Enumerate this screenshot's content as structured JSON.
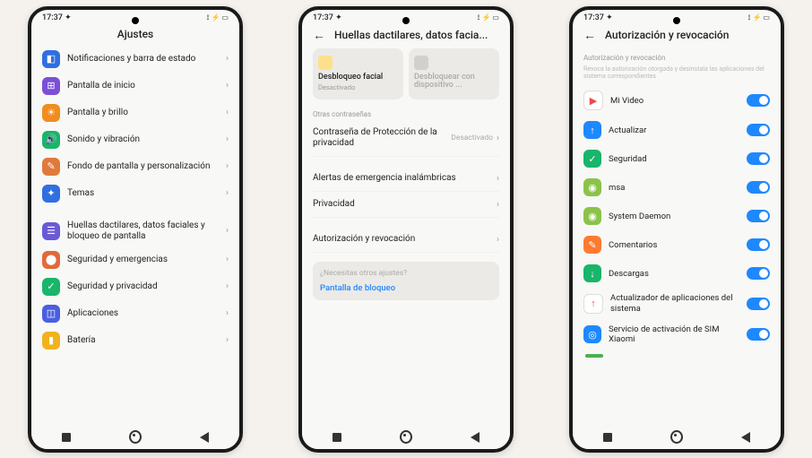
{
  "status": {
    "time": "17:37",
    "dot": "✦",
    "icons": "⟟ ⚡ ▭"
  },
  "phone1": {
    "title": "Ajustes",
    "items": [
      {
        "label": "Notificaciones y barra de estado",
        "color": "#2f6fe0",
        "glyph": "◧"
      },
      {
        "label": "Pantalla de inicio",
        "color": "#7b4fd6",
        "glyph": "⊞"
      },
      {
        "label": "Pantalla y brillo",
        "color": "#f28c1e",
        "glyph": "☀"
      },
      {
        "label": "Sonido y vibración",
        "color": "#18b56a",
        "glyph": "🔊"
      },
      {
        "label": "Fondo de pantalla y personalización",
        "color": "#e07a3b",
        "glyph": "✎"
      },
      {
        "label": "Temas",
        "color": "#2f6fe0",
        "glyph": "✦"
      }
    ],
    "items2": [
      {
        "label": "Huellas dactilares, datos faciales y bloqueo de pantalla",
        "color": "#6a5ad6",
        "glyph": "☰"
      },
      {
        "label": "Seguridad y emergencias",
        "color": "#e06a3b",
        "glyph": "⬤"
      },
      {
        "label": "Seguridad y privacidad",
        "color": "#18b56a",
        "glyph": "✓"
      },
      {
        "label": "Aplicaciones",
        "color": "#4a5fe0",
        "glyph": "◫"
      },
      {
        "label": "Batería",
        "color": "#f2b21e",
        "glyph": "▮"
      }
    ]
  },
  "phone2": {
    "title": "Huellas dactilares, datos facia...",
    "card1": {
      "title": "Desbloqueo facial",
      "sub": "Desactivado"
    },
    "card2": {
      "title": "Desbloquear con dispositivo ...",
      "sub": ""
    },
    "section1": "Otras contraseñas",
    "rows": [
      {
        "label": "Contraseña de Protección de la privacidad",
        "val": "Desactivado"
      },
      {
        "label": "Alertas de emergencia inalámbricas",
        "val": ""
      },
      {
        "label": "Privacidad",
        "val": ""
      },
      {
        "label": "Autorización y revocación",
        "val": ""
      }
    ],
    "help": {
      "q": "¿Necesitas otros ajustes?",
      "link": "Pantalla de bloqueo"
    }
  },
  "phone3": {
    "title": "Autorización y revocación",
    "note_title": "Autorización y revocación",
    "note": "Revoca la autorización otorgada y desinstala las aplicaciones del sistema correspondientes",
    "apps": [
      {
        "label": "Mi Video",
        "color": "#fff",
        "border": "#ddd",
        "glyph": "▶",
        "glyphColor": "#e84c4c"
      },
      {
        "label": "Actualizar",
        "color": "#1e88ff",
        "glyph": "↑"
      },
      {
        "label": "Seguridad",
        "color": "#18b56a",
        "glyph": "✓"
      },
      {
        "label": "msa",
        "color": "#8bc34a",
        "glyph": "◉"
      },
      {
        "label": "System Daemon",
        "color": "#8bc34a",
        "glyph": "◉"
      },
      {
        "label": "Comentarios",
        "color": "#ff7a2f",
        "glyph": "✎"
      },
      {
        "label": "Descargas",
        "color": "#18b56a",
        "glyph": "↓"
      },
      {
        "label": "Actualizador de aplicaciones del sistema",
        "color": "#fff",
        "border": "#ddd",
        "glyph": "↑",
        "glyphColor": "#e84c4c"
      },
      {
        "label": "Servicio de activación de SIM Xiaomi",
        "color": "#1e88ff",
        "glyph": "◎"
      }
    ]
  }
}
